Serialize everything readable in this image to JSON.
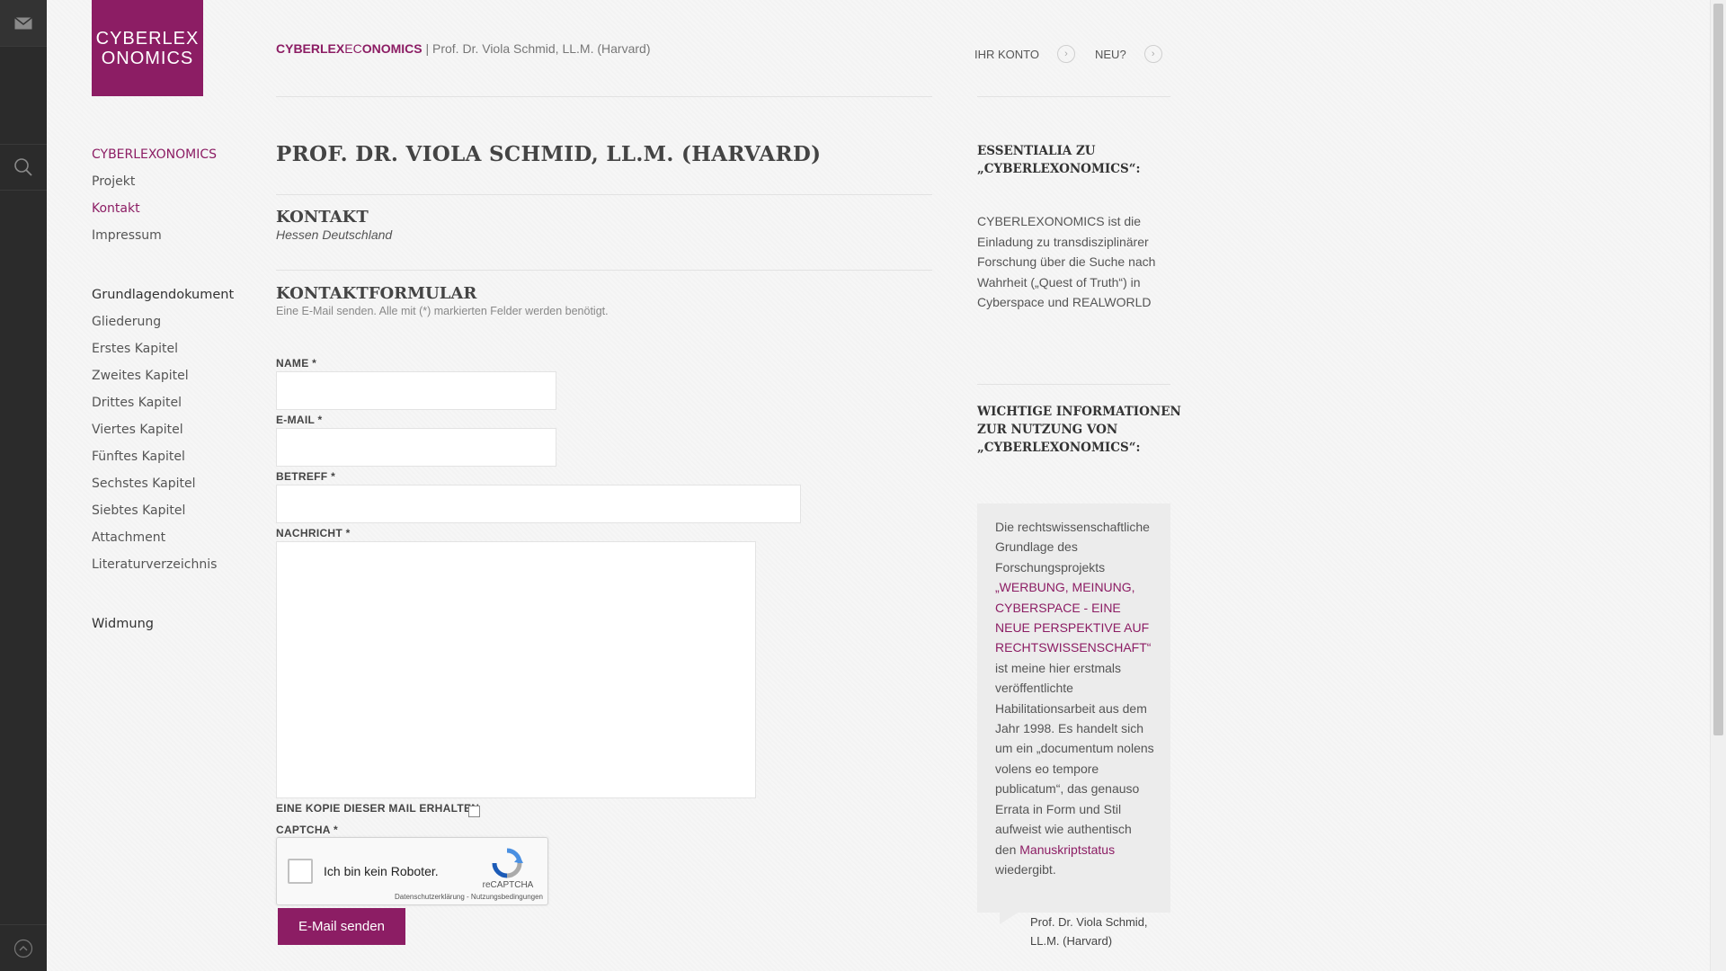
{
  "brand": {
    "logo_line1": "CYBERLEX",
    "logo_line2": "ONOMICS",
    "crumb_part1": "CYBERLEX",
    "crumb_part2": "EC",
    "crumb_part3": "ONOMICS",
    "crumb_sep": " | ",
    "crumb_person": "Prof. Dr. Viola Schmid, LL.M. (Harvard)"
  },
  "topnav": {
    "account_label": "IHR KONTO",
    "new_label": "NEU?"
  },
  "nav": {
    "items_top": [
      "CYBERLEXONOMICS",
      "Projekt",
      "Kontakt",
      "Impressum"
    ],
    "group_title": "Grundlagendokument",
    "items_group": [
      "Gliederung",
      "Erstes Kapitel",
      "Zweites Kapitel",
      "Drittes Kapitel",
      "Viertes Kapitel",
      "Fünftes Kapitel",
      "Sechstes Kapitel",
      "Siebtes Kapitel",
      "Attachment",
      "Literaturverzeichnis"
    ],
    "dedication": "Widmung"
  },
  "main": {
    "title": "PROF. DR. VIOLA SCHMID, LL.M. (HARVARD)",
    "contact_heading": "KONTAKT",
    "contact_location": "Hessen Deutschland",
    "form_heading": "KONTAKTFORMULAR",
    "form_note": "Eine E-Mail senden. Alle mit (*) markierten Felder werden benötigt.",
    "name_label": "NAME *",
    "email_label": "E-MAIL *",
    "subject_label": "BETREFF *",
    "message_label": "NACHRICHT *",
    "copy_label": "EINE KOPIE DIESER MAIL ERHALTEN",
    "captcha_label": "CAPTCHA *",
    "captcha_text": "Ich bin kein Roboter.",
    "captcha_brand": "reCAPTCHA",
    "captcha_links": "Datenschutzerklärung - Nutzungsbedingungen",
    "submit_label": "E-Mail senden"
  },
  "sidebar": {
    "essentialia_heading_1": "ESSENTIALIA ZU",
    "essentialia_heading_2": "„CYBERLEXONOMICS“:",
    "essentialia_text": "CYBERLEXONOMICS ist die Einladung zu transdisziplinärer Forschung über die Suche nach Wahrheit („Quest of Truth“) in Cyberspace und REALWORLD",
    "info_heading_1": "WICHTIGE INFORMATIONEN",
    "info_heading_2": "ZUR NUTZUNG VON",
    "info_heading_3": "„CYBERLEXONOMICS“:",
    "quote_part1": "Die rechtswissenschaftliche Grundlage des Forschungsprojekts ",
    "quote_link": "„WERBUNG, MEINUNG, CYBERSPACE - EINE NEUE PERSPEKTIVE AUF RECHTSWISSENSCHAFT“",
    "quote_part2": " ist meine hier erstmals veröffentlichte Habilitationsarbeit  aus dem Jahr 1998. Es handelt sich um ein „documentum nolens volens eo tempore publicatum“, das genauso Errata in Form und Stil aufweist wie authentisch den ",
    "quote_link2": "Manuskriptstatus",
    "quote_part3": " wiedergibt.",
    "quote_author": "Prof. Dr. Viola Schmid, LL.M. (Harvard)"
  },
  "colors": {
    "accent": "#8c1d64",
    "rail": "#2b2b2b"
  }
}
